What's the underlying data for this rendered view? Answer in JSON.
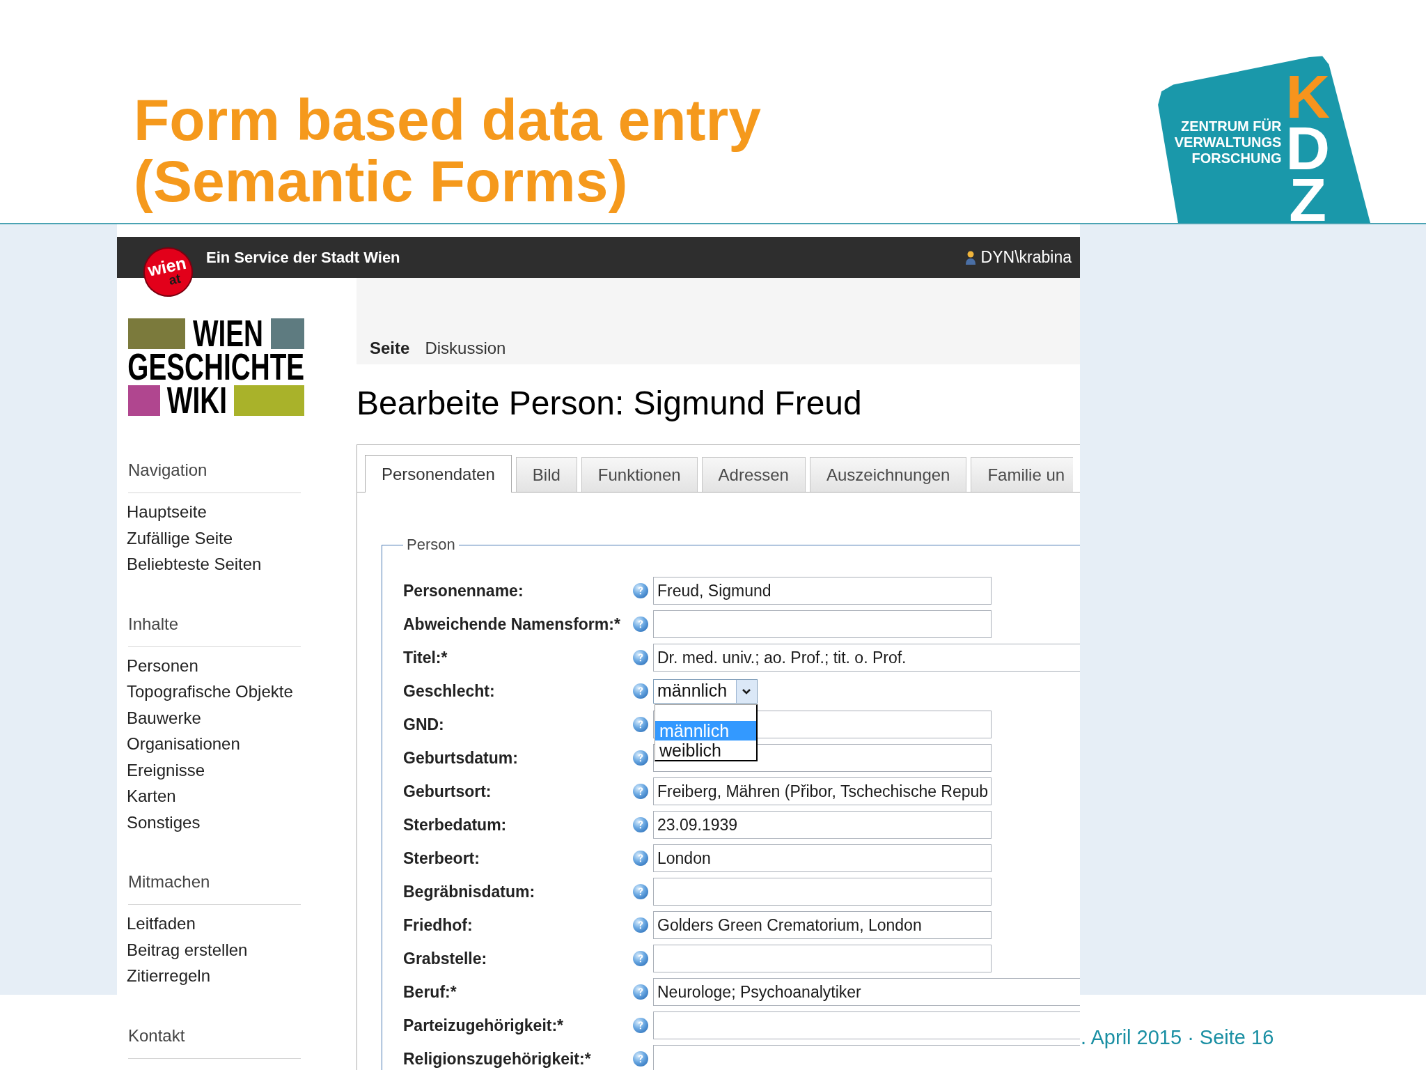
{
  "title": [
    "Form based data entry",
    "(Semantic Forms)"
  ],
  "logo": {
    "tagline": [
      "ZENTRUM FÜR",
      "VERWALTUNGS",
      "FORSCHUNG"
    ],
    "letters": [
      {
        "text": "K",
        "color": "#f7941d"
      },
      {
        "text": "D",
        "color": "#ffffff"
      },
      {
        "text": "Z",
        "color": "#ffffff"
      }
    ]
  },
  "top_bar": {
    "badge": [
      "wien",
      "at"
    ],
    "service": "Ein Service der Stadt Wien",
    "user": "DYN\\krabina"
  },
  "sidebar": {
    "logo": [
      "WIEN",
      "GESCHICHTE",
      "WIKI"
    ],
    "sections": [
      {
        "heading": "Navigation",
        "items": [
          "Hauptseite",
          "Zufällige Seite",
          "Beliebteste Seiten"
        ]
      },
      {
        "heading": "Inhalte",
        "items": [
          "Personen",
          "Topografische Objekte",
          "Bauwerke",
          "Organisationen",
          "Ereignisse",
          "Karten",
          "Sonstiges"
        ]
      },
      {
        "heading": "Mitmachen",
        "items": [
          "Leitfaden",
          "Beitrag erstellen",
          "Zitierregeln"
        ]
      },
      {
        "heading": "Kontakt"
      }
    ]
  },
  "page_tabs": [
    {
      "label": "Seite",
      "selected": true
    },
    {
      "label": "Diskussion",
      "selected": false
    }
  ],
  "heading": "Bearbeite Person: Sigmund Freud",
  "form_tabs": [
    {
      "label": "Personendaten",
      "selected": true
    },
    {
      "label": "Bild",
      "selected": false
    },
    {
      "label": "Funktionen",
      "selected": false
    },
    {
      "label": "Adressen",
      "selected": false
    },
    {
      "label": "Auszeichnungen",
      "selected": false
    },
    {
      "label": "Familie un",
      "selected": false
    }
  ],
  "fieldset": {
    "legend": "Person",
    "fields": [
      {
        "label": "Personenname:",
        "kind": "text",
        "value": "Freud, Sigmund"
      },
      {
        "label": "Abweichende Namensform:*",
        "kind": "text"
      },
      {
        "label": "Titel:*",
        "kind": "long_text",
        "value": "Dr. med. univ.; ao. Prof.; tit. o. Prof."
      },
      {
        "label": "Geschlecht:",
        "kind": "select",
        "value": "männlich",
        "expanded": true,
        "blank_option": true,
        "options": [
          {
            "label": "männlich",
            "selected": true
          },
          {
            "label": "weiblich",
            "selected": false
          }
        ]
      },
      {
        "label": "GND:",
        "kind": "text"
      },
      {
        "label": "Geburtsdatum:",
        "kind": "text"
      },
      {
        "label": "Geburtsort:",
        "kind": "text",
        "value": "Freiberg, Mähren (Přibor, Tschechische Repub"
      },
      {
        "label": "Sterbedatum:",
        "kind": "text",
        "value": "23.09.1939"
      },
      {
        "label": "Sterbeort:",
        "kind": "text",
        "value": "London"
      },
      {
        "label": "Begräbnisdatum:",
        "kind": "text"
      },
      {
        "label": "Friedhof:",
        "kind": "text",
        "value": "Golders Green Crematorium, London"
      },
      {
        "label": "Grabstelle:",
        "kind": "text"
      },
      {
        "label": "Beruf:*",
        "kind": "long_text",
        "value": "Neurologe; Psychoanalytiker"
      },
      {
        "label": "Parteizugehörigkeit:*",
        "kind": "long_text"
      },
      {
        "label": "Religionszugehörigkeit:*",
        "kind": "long_text"
      }
    ]
  },
  "footer": ". April 2015 · Seite 16"
}
